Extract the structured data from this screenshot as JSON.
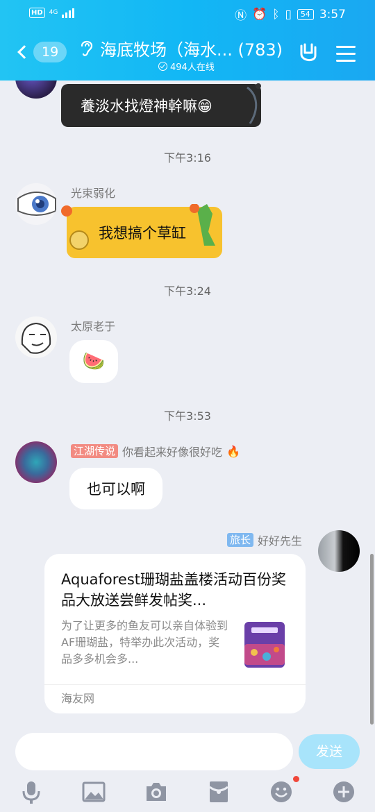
{
  "status_bar": {
    "hd": "HD",
    "network": "4G",
    "time": "3:57",
    "battery": "54"
  },
  "header": {
    "unread_count": "19",
    "title": "海底牧场（海水... (783)",
    "online_text": "494人在线"
  },
  "messages": [
    {
      "type": "bubble",
      "text": "養淡水找燈神幹嘛😁"
    },
    {
      "type": "time",
      "text": "下午3:16"
    },
    {
      "type": "bubble",
      "sender": "光束弱化",
      "text": "我想搞个草缸"
    },
    {
      "type": "time",
      "text": "下午3:24"
    },
    {
      "type": "bubble",
      "sender": "太原老于",
      "text": "🍉"
    },
    {
      "type": "time",
      "text": "下午3:53"
    },
    {
      "type": "bubble",
      "sender": "你看起来好像很好吃",
      "sender_tag": "江湖传说",
      "text": "也可以啊"
    },
    {
      "type": "card",
      "sender": "好好先生",
      "sender_tag": "旅长",
      "title": "Aquaforest珊瑚盐盖楼活动百份奖品大放送尝鲜发帖奖...",
      "description": "为了让更多的鱼友可以亲自体验到AF珊瑚盐，特举办此次活动，奖品多多机会多...",
      "source": "海友网"
    }
  ],
  "composer": {
    "input_value": "",
    "send_label": "发送"
  },
  "toolbar_icons": [
    "mic-icon",
    "image-icon",
    "camera-icon",
    "red-packet-icon",
    "emoji-icon",
    "plus-icon"
  ],
  "colors": {
    "header_blue": "#12b7f5",
    "tag_red": "#f28b82",
    "tag_blue": "#7fb8f0",
    "send_disabled": "#a8e4fb"
  }
}
